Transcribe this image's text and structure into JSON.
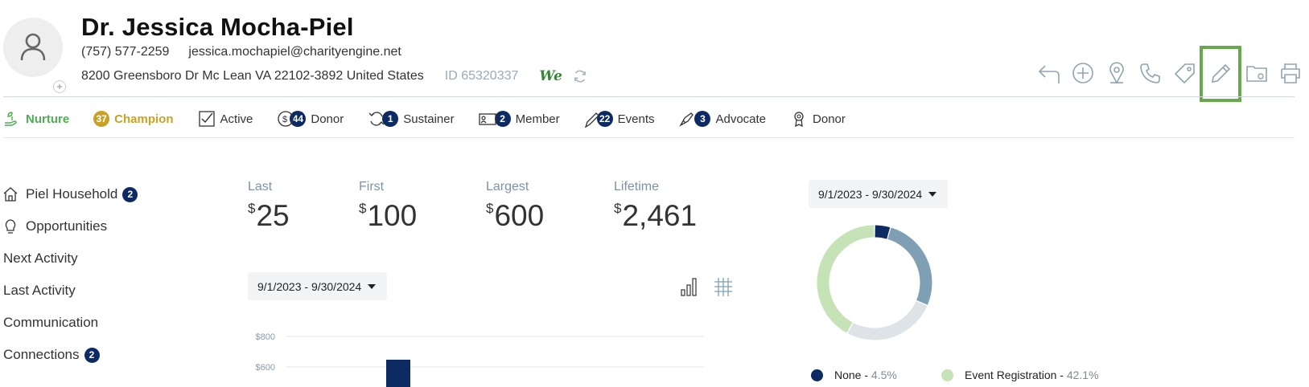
{
  "contact": {
    "name": "Dr. Jessica Mocha-Piel",
    "phone": "(757) 577-2259",
    "email": "jessica.mochapiel@charityengine.net",
    "address": "8200 Greensboro Dr Mc Lean VA 22102-3892 United States",
    "id_text": "ID 65320337",
    "we_label": "We"
  },
  "toolbar": {
    "icons": [
      "back-arrow-icon",
      "add-circle-icon",
      "location-pin-icon",
      "phone-icon",
      "tag-icon",
      "pencil-edit-icon",
      "folder-settings-icon",
      "printer-icon"
    ],
    "selected": "pencil-edit-icon",
    "selected_color": "#6aa84f"
  },
  "tags": {
    "nurture": {
      "label": "Nurture"
    },
    "champion": {
      "count": "37",
      "label": "Champion"
    },
    "active": {
      "label": "Active"
    },
    "donor": {
      "count": "44",
      "label": "Donor"
    },
    "sustainer": {
      "count": "1",
      "label": "Sustainer"
    },
    "member": {
      "count": "2",
      "label": "Member"
    },
    "events": {
      "count": "22",
      "label": "Events"
    },
    "advocate": {
      "count": "3",
      "label": "Advocate"
    },
    "donor2": {
      "label": "Donor"
    }
  },
  "nav": {
    "household": {
      "label": "Piel Household",
      "count": "2"
    },
    "opportunities": {
      "label": "Opportunities"
    },
    "next_activity": {
      "label": "Next Activity"
    },
    "last_activity": {
      "label": "Last Activity"
    },
    "communication": {
      "label": "Communication"
    },
    "connections": {
      "label": "Connections",
      "count": "2"
    }
  },
  "stats": {
    "currency": "$",
    "last": {
      "label": "Last",
      "value": "25"
    },
    "first": {
      "label": "First",
      "value": "100"
    },
    "largest": {
      "label": "Largest",
      "value": "600"
    },
    "lifetime": {
      "label": "Lifetime",
      "value": "2,461"
    }
  },
  "date_range_left": "9/1/2023 - 9/30/2024",
  "date_range_right": "9/1/2023 - 9/30/2024",
  "chart_data": [
    {
      "type": "bar",
      "y_tick_labels": [
        "$800",
        "$600"
      ],
      "ylim_visible": [
        600,
        800
      ],
      "values_visible": [
        {
          "index": 2,
          "value_over": 600
        }
      ],
      "bar_color": "#0d2a63",
      "grid": true
    },
    {
      "type": "pie",
      "donut": true,
      "slices": [
        {
          "name": "None",
          "pct": 4.5,
          "color": "#0d2a63"
        },
        {
          "name": "",
          "pct": 27.0,
          "color": "#7f9fb4"
        },
        {
          "name": "",
          "pct": 26.4,
          "color": "#dde3e7"
        },
        {
          "name": "Event Registration",
          "pct": 42.1,
          "color": "#c5e3b7"
        }
      ],
      "legend_position": "bottom"
    }
  ],
  "legend": {
    "none": {
      "label": "None - ",
      "pct": "4.5%"
    },
    "event_registration": {
      "label": "Event Registration - ",
      "pct": "42.1%"
    }
  }
}
